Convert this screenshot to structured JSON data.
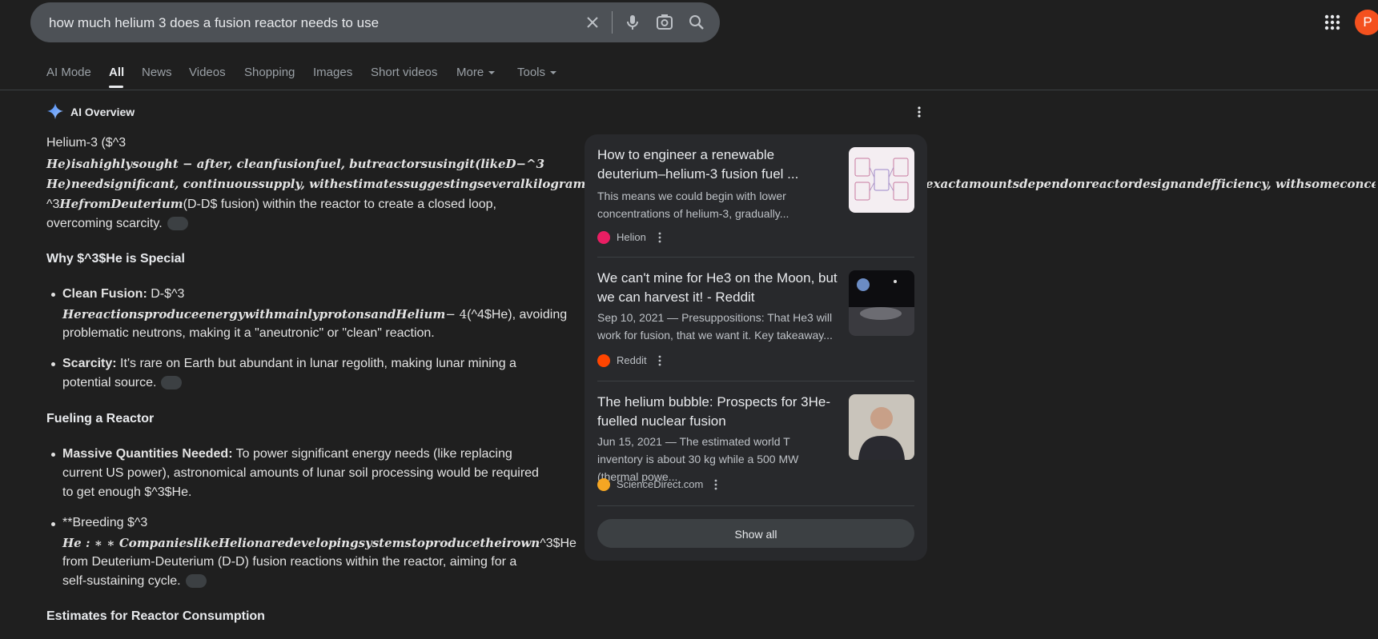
{
  "search": {
    "query": "how much helium 3 does a fusion reactor needs to use",
    "clear_icon": "close-icon",
    "voice_icon": "mic-icon",
    "lens_icon": "camera-search-icon",
    "search_icon": "search-icon"
  },
  "header": {
    "apps_icon": "apps-grid-icon",
    "avatar_letter": "P",
    "avatar_color": "#f4511e"
  },
  "tabs": [
    {
      "label": "AI Mode"
    },
    {
      "label": "All",
      "active": true
    },
    {
      "label": "News"
    },
    {
      "label": "Videos"
    },
    {
      "label": "Shopping"
    },
    {
      "label": "Images"
    },
    {
      "label": "Short videos"
    },
    {
      "label": "More"
    },
    {
      "label": "Tools"
    }
  ],
  "ai_overview": {
    "title": "AI Overview",
    "intro_lines": [
      "Helium-3 ($^3",
      "He)isahighlysought − after, cleanfusionfuel, butreactorsusingit(likeD−^3",
      "He)needsignificant, continuoussupply, withestimatessuggestingseveralkilogramstotensofkilogramsannuallyforlargeplants, thoughexactamountsdependonreactordesignandefficiency, withsomeconceptsaimingtobreed",
      "^3",
      "HefromDeuterium",
      "(D-D$ fusion) within the reactor to create a closed loop,",
      "overcoming scarcity."
    ],
    "sections": [
      {
        "heading": "Why $^3$He is Special",
        "bullets": [
          {
            "bold": "Clean Fusion:",
            "lines": [
              "D-$^3",
              "HereactionsproduceenergywithmainlyprotonsandHelium",
              "− 4",
              "(^4$He), avoiding",
              "problematic neutrons, making it a \"aneutronic\" or \"clean\" reaction."
            ]
          },
          {
            "bold": "Scarcity:",
            "lines": [
              "It's rare on Earth but abundant in lunar regolith, making lunar mining a",
              "potential source."
            ]
          }
        ]
      },
      {
        "heading": "Fueling a Reactor",
        "bullets": [
          {
            "bold": "Massive Quantities Needed:",
            "lines": [
              "To power significant energy needs (like replacing",
              "current US power), astronomical amounts of lunar soil processing would be required",
              "to get enough $^3$He."
            ]
          },
          {
            "bold": "",
            "lines": [
              "**Breeding $^3",
              "He : ∗ ∗ CompanieslikeHelionaredevelopingsystemstoproducetheirown",
              "^3$He",
              "from Deuterium-Deuterium (D-D) fusion reactions within the reactor, aiming for a",
              "self-sustaining cycle."
            ]
          }
        ]
      },
      {
        "heading": "Estimates for Reactor Consumption"
      }
    ]
  },
  "sources": {
    "cards": [
      {
        "title": "How to engineer a renewable deuterium–helium-3 fusion fuel ...",
        "snippet": "This means we could begin with lower concentrations of helium-3, gradually...",
        "source": "Helion",
        "favicon_color": "#e91e63"
      },
      {
        "title": "We can't mine for He3 on the Moon, but we can harvest it! - Reddit",
        "snippet": "Sep 10, 2021 — Presuppositions: That He3 will work for fusion, that we want it. Key takeaway...",
        "source": "Reddit",
        "favicon_color": "#ff4500"
      },
      {
        "title": "The helium bubble: Prospects for 3He-fuelled nuclear fusion",
        "snippet": "Jun 15, 2021 — The estimated world T inventory is about 30 kg while a 500 MW (thermal powe...",
        "source": "ScienceDirect.com",
        "favicon_color": "#f5a623"
      }
    ],
    "show_all": "Show all"
  }
}
